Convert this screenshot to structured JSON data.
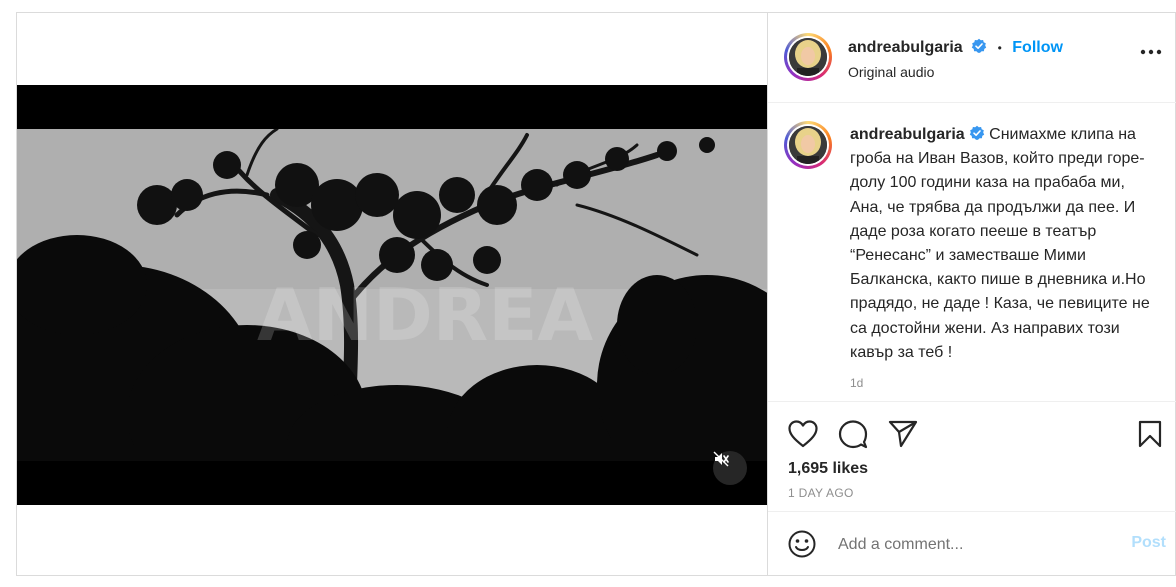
{
  "post": {
    "username": "andreabulgaria",
    "follow_label": "Follow",
    "separator": "•",
    "audio": "Original audio",
    "caption": "Снимахме клипа на гроба на Иван Вазов, който преди горе-долу 100 години каза на прабаба ми, Ана, че трябва да продължи да пее. И даде роза когато пееше в театър “Ренесанс” и заместваше Мими Балканска, както пише в дневника и.Но прадядо, не даде ! Каза, че певиците не са достойни жени. Аз направих този кавър за теб !",
    "caption_age": "1d",
    "likes": "1,695 likes",
    "date": "1 DAY AGO",
    "video_watermark": "ANDREA",
    "muted": true
  },
  "comment": {
    "placeholder": "Add a comment...",
    "post_label": "Post"
  },
  "colors": {
    "link": "#0095f6",
    "post_disabled": "#b2dffc",
    "verified": "#3897f0"
  },
  "icons": [
    "more-icon",
    "verified-badge-icon",
    "heart-icon",
    "comment-icon",
    "share-icon",
    "save-icon",
    "emoji-icon",
    "mute-icon"
  ]
}
